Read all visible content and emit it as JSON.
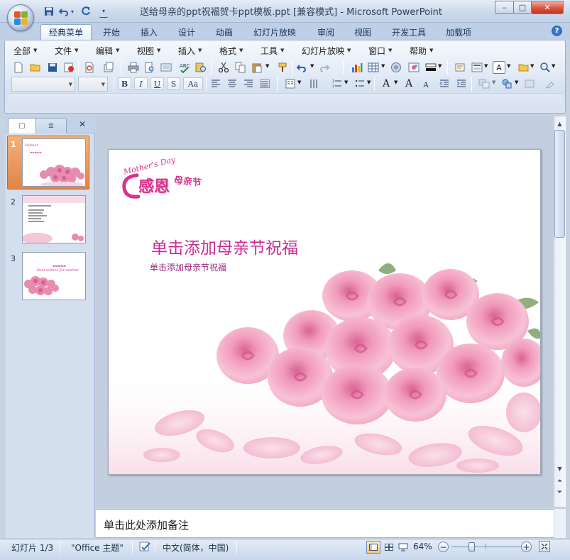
{
  "window": {
    "title": "送给母亲的ppt祝福贺卡ppt模板.ppt [兼容模式] - Microsoft PowerPoint",
    "controls": {
      "minimize": "–",
      "maximize": "□",
      "close": "✕"
    }
  },
  "quick_access": [
    {
      "name": "save",
      "glyph": "💾"
    },
    {
      "name": "undo",
      "glyph": "↶"
    },
    {
      "name": "undo-dropdown",
      "glyph": "▾"
    },
    {
      "name": "redo",
      "glyph": "↷"
    },
    {
      "name": "customize",
      "glyph": "▾"
    }
  ],
  "ribbon_tabs": [
    "经典菜单",
    "开始",
    "插入",
    "设计",
    "动画",
    "幻灯片放映",
    "审阅",
    "视图",
    "开发工具",
    "加载项"
  ],
  "ribbon_help": "?",
  "classic_menu": [
    "全部",
    "文件",
    "编辑",
    "视图",
    "插入",
    "格式",
    "工具",
    "幻灯片放映",
    "窗口",
    "帮助"
  ],
  "format_buttons": [
    "B",
    "I",
    "U",
    "S",
    "Aa"
  ],
  "font_buttons": [
    "A",
    "A",
    "A"
  ],
  "pane_tabs": {
    "slides": "▢",
    "outline": "≣",
    "close": "✕"
  },
  "thumbnails": [
    {
      "number": "1",
      "selected": true
    },
    {
      "number": "2",
      "selected": false
    },
    {
      "number": "3",
      "selected": false
    }
  ],
  "slide": {
    "logo_script": "Mother's Day",
    "logo_main": "感恩",
    "logo_sub": "母亲节",
    "title": "单击添加母亲节祝福",
    "subtitle": "单击添加母亲节祝福"
  },
  "thumb3_caption": "Best wishes for mother",
  "notes": {
    "placeholder": "单击此处添加备注"
  },
  "status": {
    "slide_counter": "幻灯片 1/3",
    "theme": "\"Office 主题\"",
    "language": "中文(简体，中国)",
    "zoom": "64%",
    "zoom_level": 64
  },
  "colors": {
    "accent_pink": "#cc2a93",
    "subtitle_purple": "#9b2483",
    "selected_thumb": "#e99251"
  }
}
